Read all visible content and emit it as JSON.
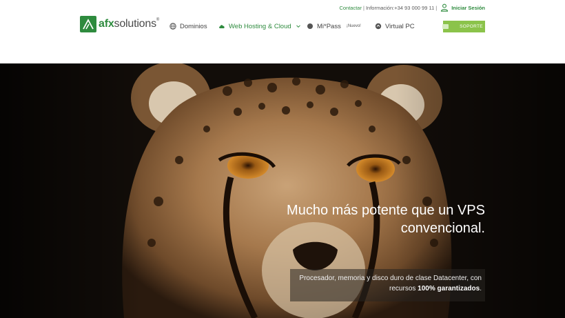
{
  "utility": {
    "contact_label": "Contactar",
    "info_label": "Información:",
    "phone": "+34 93 000 99 11",
    "login_label": "Iniciar Sesión"
  },
  "logo": {
    "strong": "afx",
    "rest": "solutions",
    "mark": "®"
  },
  "nav": [
    {
      "label": "Dominios",
      "icon": "globe-icon"
    },
    {
      "label": "Web Hosting & Cloud",
      "icon": "cloud-icon"
    },
    {
      "label": "Mi*Pass",
      "icon": "circle-icon",
      "badge": "¡Nuevo!"
    },
    {
      "label": "Virtual PC",
      "icon": "pc-icon"
    }
  ],
  "support": {
    "label": "SOPORTE"
  },
  "hero": {
    "headline_line1": "Mucho más potente que un VPS",
    "headline_line2": "convencional.",
    "sub_text": "Procesador, memoria y disco duro de clase Datacenter, con recursos",
    "sub_strong": "100% garantizados",
    "sub_end": "."
  },
  "colors": {
    "brand_green": "#2e8b3e",
    "support_green": "#8bc34a",
    "hero_bg": "#0d0a08"
  }
}
